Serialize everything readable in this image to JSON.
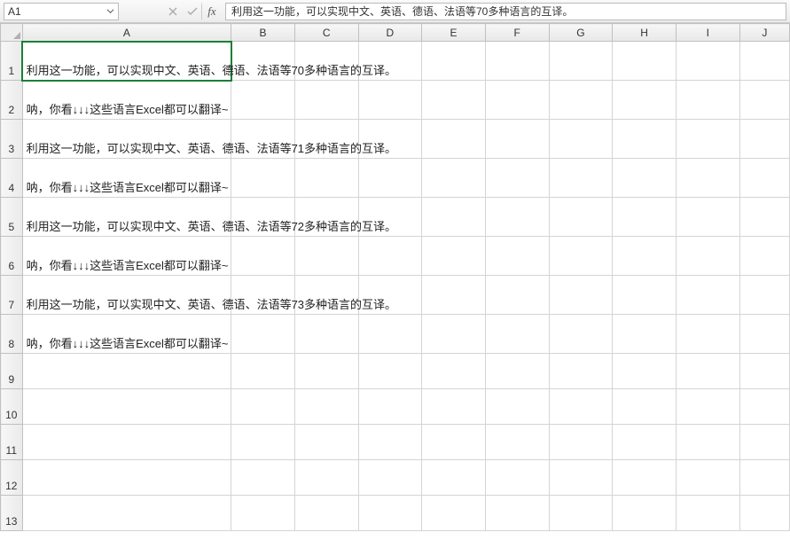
{
  "formula_bar": {
    "name_box": "A1",
    "fx_label": "fx",
    "formula_value": "利用这一功能，可以实现中文、英语、德语、法语等70多种语言的互译。"
  },
  "columns": [
    "A",
    "B",
    "C",
    "D",
    "E",
    "F",
    "G",
    "H",
    "I",
    "J"
  ],
  "rows": [
    {
      "num": "1",
      "a": "利用这一功能，可以实现中文、英语、德语、法语等70多种语言的互译。",
      "h": "tall"
    },
    {
      "num": "2",
      "a": "呐，你看↓↓↓这些语言Excel都可以翻译~",
      "h": "tall"
    },
    {
      "num": "3",
      "a": "利用这一功能，可以实现中文、英语、德语、法语等71多种语言的互译。",
      "h": "tall"
    },
    {
      "num": "4",
      "a": "呐，你看↓↓↓这些语言Excel都可以翻译~",
      "h": "tall"
    },
    {
      "num": "5",
      "a": "利用这一功能，可以实现中文、英语、德语、法语等72多种语言的互译。",
      "h": "tall"
    },
    {
      "num": "6",
      "a": "呐，你看↓↓↓这些语言Excel都可以翻译~",
      "h": "tall"
    },
    {
      "num": "7",
      "a": "利用这一功能，可以实现中文、英语、德语、法语等73多种语言的互译。",
      "h": "tall"
    },
    {
      "num": "8",
      "a": "呐，你看↓↓↓这些语言Excel都可以翻译~",
      "h": "tall"
    },
    {
      "num": "9",
      "a": "",
      "h": "norm"
    },
    {
      "num": "10",
      "a": "",
      "h": "norm"
    },
    {
      "num": "11",
      "a": "",
      "h": "norm"
    },
    {
      "num": "12",
      "a": "",
      "h": "norm"
    },
    {
      "num": "13",
      "a": "",
      "h": "norm"
    }
  ],
  "active_cell": "A1"
}
